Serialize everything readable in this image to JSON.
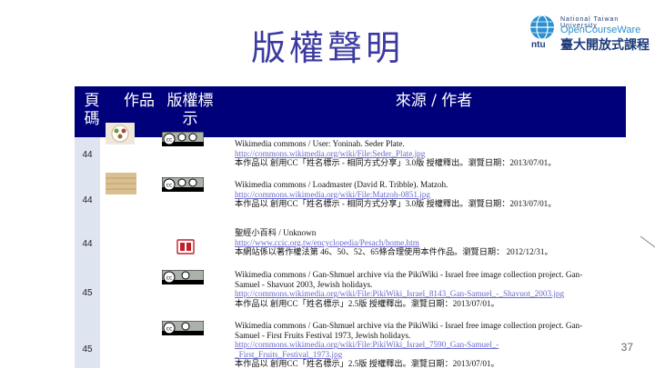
{
  "slide": {
    "title": "版權聲明",
    "page_number": "37"
  },
  "logo": {
    "university": "National Taiwan University",
    "brand": "OpenCourseWare",
    "chinese": "臺大開放式課程",
    "abbr": "ntu"
  },
  "table": {
    "headers": {
      "page": "頁\n碼",
      "work": "作品",
      "license": "版權標\n示",
      "source": "來源 / 作者"
    },
    "rows": [
      {
        "page": "44",
        "license": "cc-by-sa",
        "lines": [
          {
            "text": "Wikimedia commons / User: Yoninah. Seder Plate.",
            "link": false
          },
          {
            "text": "http://commons.wikimedia.org/wiki/File:Seder_Plate.jpg",
            "link": true
          },
          {
            "text": "本作品以 創用CC「姓名標示 - 相同方式分享」3.0版 授權釋出。瀏覽日期：2013/07/01。",
            "link": false
          }
        ]
      },
      {
        "page": "44",
        "license": "cc-by-sa",
        "lines": [
          {
            "text": "Wikimedia commons / Loadmaster (David R. Tribble). Matzoh.",
            "link": false
          },
          {
            "text": "http://commons.wikimedia.org/wiki/File:Matzoh-0851.jpg",
            "link": true
          },
          {
            "text": "本作品以 創用CC「姓名標示 - 相同方式分享」3.0版 授權釋出。瀏覽日期：2013/07/01。",
            "link": false
          }
        ]
      },
      {
        "page": "44",
        "license": "fair-use",
        "lines": [
          {
            "text": "聖經小百科 / Unknown",
            "link": false
          },
          {
            "text": "http://www.ccic.org.tw/encyclopedia/Pesach/home.htm",
            "link": true
          },
          {
            "text": "本網站係以著作權法第 46、50、52、65條合理使用本件作品。瀏覽日期： 2012/12/31。",
            "link": false
          }
        ]
      },
      {
        "page": "45",
        "license": "cc-by",
        "lines": [
          {
            "text": "Wikimedia commons / Gan-Shmuel archive via the PikiWiki - Israel free image collection project. Gan-",
            "link": false
          },
          {
            "text": "Samuel - Shavuot 2003, Jewish holidays.",
            "link": false
          },
          {
            "text": "http://commons.wikimedia.org/wiki/File:PikiWiki_Israel_8143_Gan-Samuel_-_Shavuot_2003.jpg",
            "link": true
          },
          {
            "text": "本作品以 創用CC「姓名標示」2.5版 授權釋出。瀏覽日期：2013/07/01。",
            "link": false
          }
        ]
      },
      {
        "page": "45",
        "license": "cc-by",
        "lines": [
          {
            "text": "Wikimedia commons / Gan-Shmuel archive via the PikiWiki - Israel free image collection project. Gan-",
            "link": false
          },
          {
            "text": "Samuel - First Fruits Festival 1973, Jewish holidays.",
            "link": false
          },
          {
            "text": "http://commons.wikimedia.org/wiki/File:PikiWiki_Israel_7590_Gan-Samuel_-",
            "link": true
          },
          {
            "text": "_First_Fruits_Festival_1973.jpg",
            "link": true
          },
          {
            "text": "本作品以 創用CC「姓名標示」2.5版 授權釋出。瀏覽日期：2013/07/01。",
            "link": false
          }
        ]
      }
    ]
  }
}
